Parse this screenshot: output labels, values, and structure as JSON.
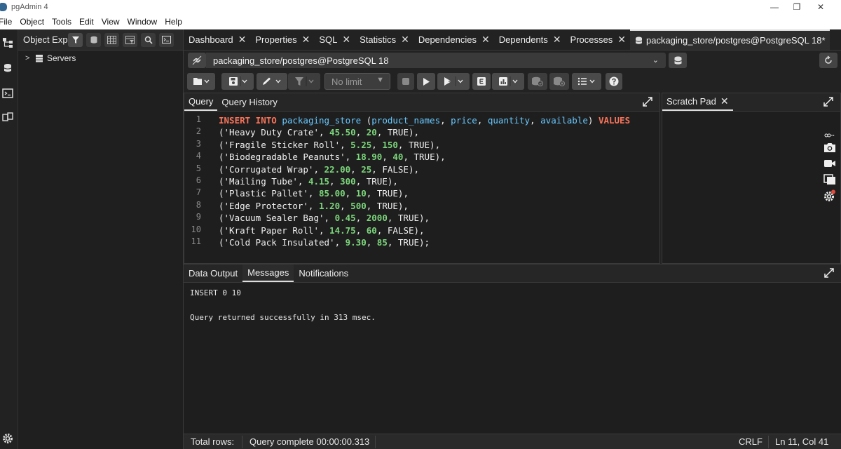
{
  "window": {
    "title": "pgAdmin 4",
    "controls": {
      "minimize": "—",
      "restore": "❐",
      "close": "✕"
    }
  },
  "menu": [
    "File",
    "Object",
    "Tools",
    "Edit",
    "View",
    "Window",
    "Help"
  ],
  "explorer": {
    "title": "Object Explorer",
    "tree": [
      {
        "label": "Servers",
        "expanded": false
      }
    ]
  },
  "tabs": [
    {
      "label": "Dashboard",
      "close": "✕"
    },
    {
      "label": "Properties",
      "close": "✕"
    },
    {
      "label": "SQL",
      "close": "✕"
    },
    {
      "label": "Statistics",
      "close": "✕"
    },
    {
      "label": "Dependencies",
      "close": "✕"
    },
    {
      "label": "Dependents",
      "close": "✕"
    },
    {
      "label": "Processes",
      "close": "✕"
    },
    {
      "label": "packaging_store/postgres@PostgreSQL 18*",
      "active": true
    }
  ],
  "connection": {
    "label": "packaging_store/postgres@PostgreSQL 18"
  },
  "toolbar": {
    "limit": "No limit"
  },
  "query_panel": {
    "tabs": [
      "Query",
      "Query History"
    ],
    "lines": [
      {
        "n": "1",
        "parts": [
          [
            "kw",
            "INSERT INTO "
          ],
          [
            "id",
            "packaging_store "
          ],
          [
            "str",
            "("
          ],
          [
            "id",
            "product_names"
          ],
          [
            "str",
            ", "
          ],
          [
            "id",
            "price"
          ],
          [
            "str",
            ", "
          ],
          [
            "id",
            "quantity"
          ],
          [
            "str",
            ", "
          ],
          [
            "id",
            "available"
          ],
          [
            "str",
            ") "
          ],
          [
            "kw",
            "VALUES"
          ]
        ]
      },
      {
        "n": "2",
        "parts": [
          [
            "str",
            "('Heavy Duty Crate', "
          ],
          [
            "num",
            "45.50"
          ],
          [
            "str",
            ", "
          ],
          [
            "num",
            "20"
          ],
          [
            "str",
            ", TRUE),"
          ]
        ]
      },
      {
        "n": "3",
        "parts": [
          [
            "str",
            "('Fragile Sticker Roll', "
          ],
          [
            "num",
            "5.25"
          ],
          [
            "str",
            ", "
          ],
          [
            "num",
            "150"
          ],
          [
            "str",
            ", TRUE),"
          ]
        ]
      },
      {
        "n": "4",
        "parts": [
          [
            "str",
            "('Biodegradable Peanuts', "
          ],
          [
            "num",
            "18.90"
          ],
          [
            "str",
            ", "
          ],
          [
            "num",
            "40"
          ],
          [
            "str",
            ", TRUE),"
          ]
        ]
      },
      {
        "n": "5",
        "parts": [
          [
            "str",
            "('Corrugated Wrap', "
          ],
          [
            "num",
            "22.00"
          ],
          [
            "str",
            ", "
          ],
          [
            "num",
            "25"
          ],
          [
            "str",
            ", FALSE),"
          ]
        ]
      },
      {
        "n": "6",
        "parts": [
          [
            "str",
            "('Mailing Tube', "
          ],
          [
            "num",
            "4.15"
          ],
          [
            "str",
            ", "
          ],
          [
            "num",
            "300"
          ],
          [
            "str",
            ", TRUE),"
          ]
        ]
      },
      {
        "n": "7",
        "parts": [
          [
            "str",
            "('Plastic Pallet', "
          ],
          [
            "num",
            "85.00"
          ],
          [
            "str",
            ", "
          ],
          [
            "num",
            "10"
          ],
          [
            "str",
            ", TRUE),"
          ]
        ]
      },
      {
        "n": "8",
        "parts": [
          [
            "str",
            "('Edge Protector', "
          ],
          [
            "num",
            "1.20"
          ],
          [
            "str",
            ", "
          ],
          [
            "num",
            "500"
          ],
          [
            "str",
            ", TRUE),"
          ]
        ]
      },
      {
        "n": "9",
        "parts": [
          [
            "str",
            "('Vacuum Sealer Bag', "
          ],
          [
            "num",
            "0.45"
          ],
          [
            "str",
            ", "
          ],
          [
            "num",
            "2000"
          ],
          [
            "str",
            ", TRUE),"
          ]
        ]
      },
      {
        "n": "10",
        "parts": [
          [
            "str",
            "('Kraft Paper Roll', "
          ],
          [
            "num",
            "14.75"
          ],
          [
            "str",
            ", "
          ],
          [
            "num",
            "60"
          ],
          [
            "str",
            ", FALSE),"
          ]
        ]
      },
      {
        "n": "11",
        "parts": [
          [
            "str",
            "('Cold Pack Insulated', "
          ],
          [
            "num",
            "9.30"
          ],
          [
            "str",
            ", "
          ],
          [
            "num",
            "85"
          ],
          [
            "str",
            ", TRUE);"
          ]
        ]
      }
    ]
  },
  "scratch": {
    "label": "Scratch Pad",
    "close": "✕"
  },
  "messages_panel": {
    "tabs": [
      "Data Output",
      "Messages",
      "Notifications"
    ],
    "active": "Messages",
    "messages": [
      "INSERT 0 10",
      "Query returned successfully in 313 msec."
    ]
  },
  "status": {
    "total_rows": "Total rows:",
    "query": "Query complete 00:00:00.313",
    "eol": "CRLF",
    "position": "Ln 11, Col 41"
  },
  "colors": {
    "keyword": "#f9745a",
    "identifier": "#67c8ff",
    "number": "#7cd67c",
    "background": "#1e1e1e"
  }
}
